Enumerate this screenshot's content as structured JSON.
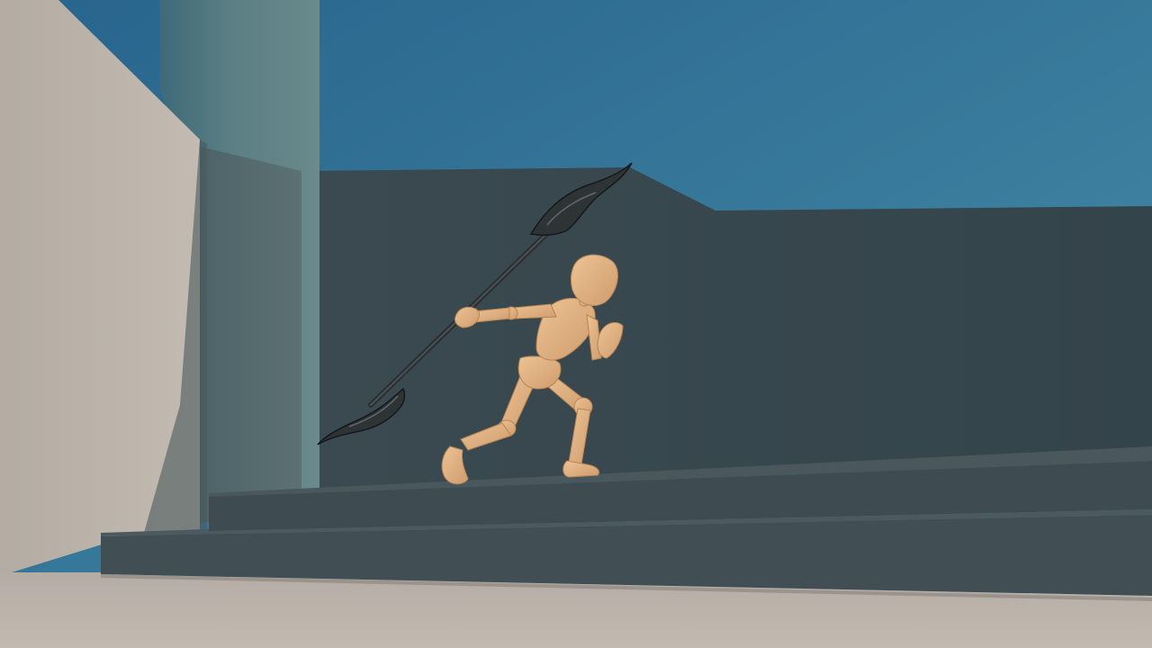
{
  "scene": {
    "kind": "3d-render",
    "subject": "wooden-mannequin-with-spear",
    "colors": {
      "sky_top": "#2b6a92",
      "sky_bottom": "#4388a3",
      "wall_shadow": "#38474d",
      "wall_lit": "#bdb5ac",
      "tower": "#4f6c72",
      "ground": "#bcb4ab",
      "steps": "#3e4b50",
      "mannequin": "#e3b485",
      "spear": "#2e3235"
    }
  }
}
